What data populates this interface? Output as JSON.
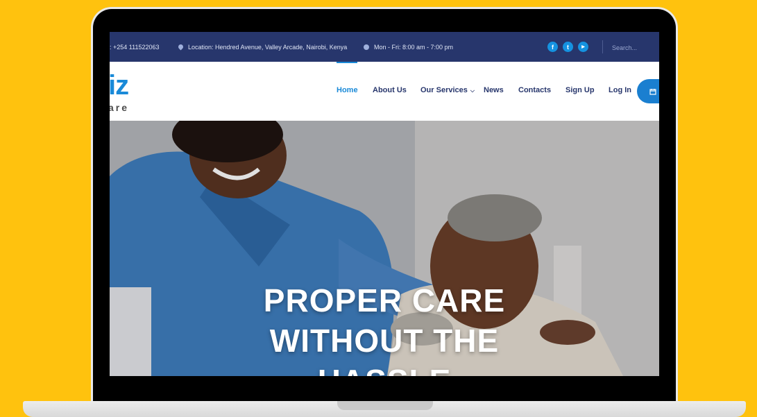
{
  "topbar": {
    "phone": ": +254 111522063",
    "location": "Location: Hendred Avenue, Valley Arcade, Nairobi, Kenya",
    "hours": "Mon - Fri: 8:00 am - 7:00 pm",
    "social": [
      {
        "label": "f",
        "icon": "facebook-icon"
      },
      {
        "label": "t",
        "icon": "twitter-icon"
      },
      {
        "label": "▶",
        "icon": "youtube-icon"
      }
    ],
    "search_placeholder": "Search..."
  },
  "logo": {
    "main": "iz",
    "sub": "are"
  },
  "nav": {
    "home": "Home",
    "about": "About Us",
    "services": "Our Services",
    "news": "News",
    "contacts": "Contacts",
    "signup": "Sign Up",
    "login": "Log In"
  },
  "hero": {
    "title": "PROPER CARE WITHOUT THE HASSLE"
  },
  "colors": {
    "background": "#FFC20E",
    "topbar": "#27366C",
    "accent": "#1A8AD8"
  }
}
